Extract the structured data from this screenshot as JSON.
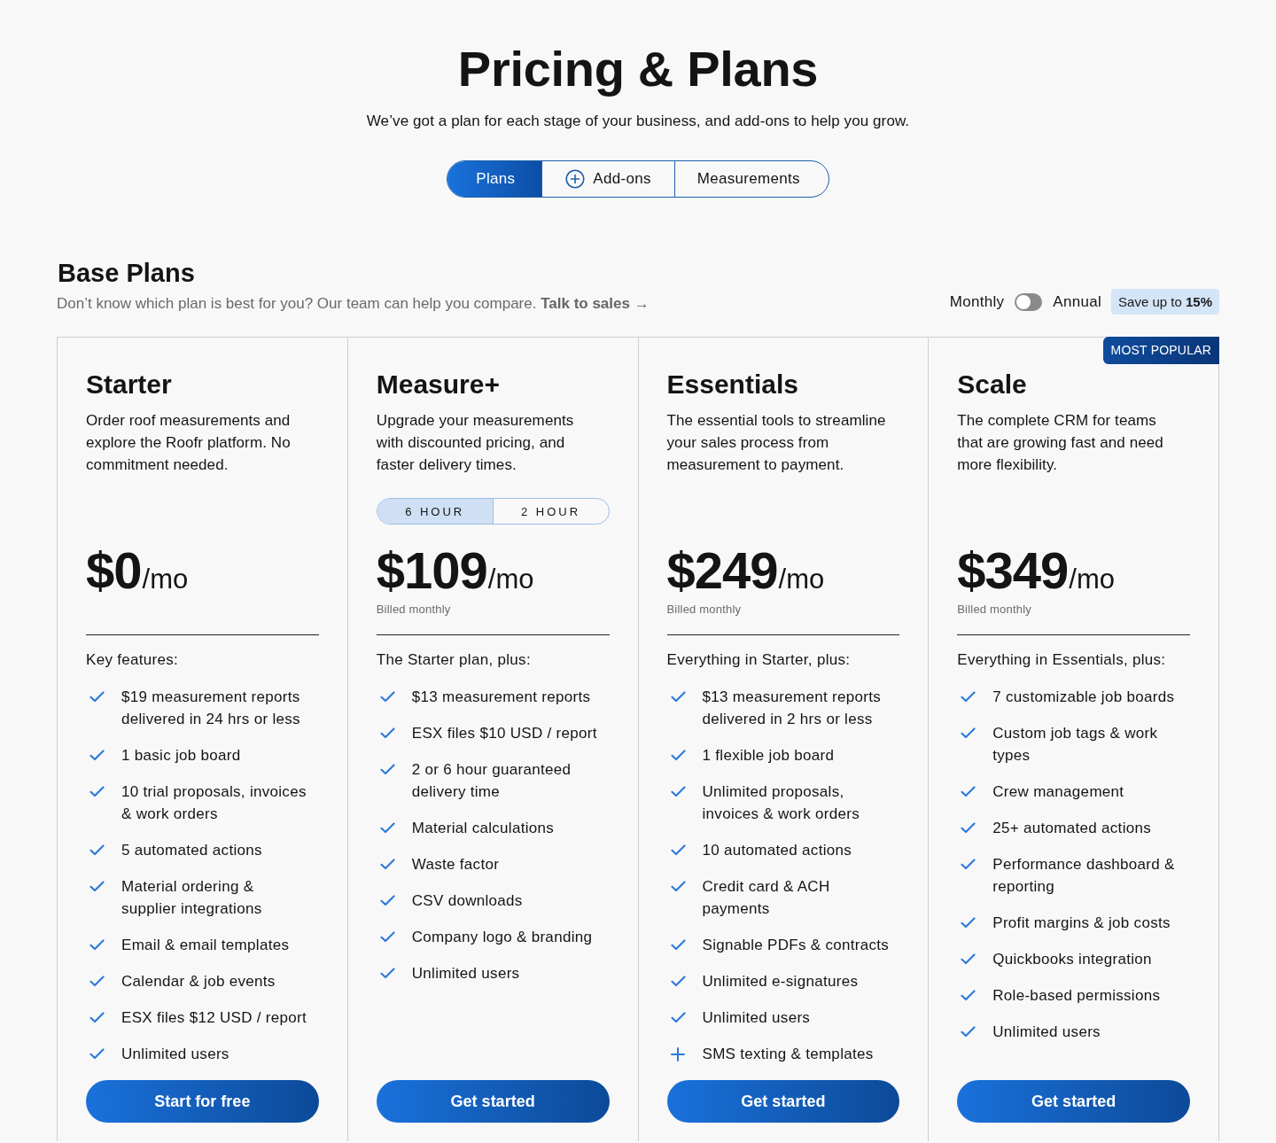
{
  "header": {
    "title": "Pricing & Plans",
    "subtitle": "We’ve got a plan for each stage of your business, and add-ons to help you grow."
  },
  "tabs": [
    {
      "label": "Plans",
      "selected": true,
      "icon": false
    },
    {
      "label": "Add-ons",
      "selected": false,
      "icon": true
    },
    {
      "label": "Measurements",
      "selected": false,
      "icon": false
    }
  ],
  "base_plans": {
    "title": "Base Plans",
    "subtitle": "Don’t know which plan is best for you? Our team can help you compare.",
    "link": "Talk to sales →",
    "billing": {
      "monthly_label": "Monthly",
      "toggle": {
        "on": false
      },
      "annual_label": "Annual",
      "savings": "Save up to **15%**"
    }
  },
  "plans": [
    {
      "name": "Starter",
      "description": "Order roof measurements and explore the Roofr platform. No commitment needed.",
      "price": "$0",
      "period": "/mo",
      "features_heading": "Key features:",
      "features": [
        {
          "kind": "check",
          "text": "$19 measurement reports delivered in 24 hrs or less"
        },
        {
          "kind": "check",
          "text": "1 basic job board"
        },
        {
          "kind": "check",
          "text": "10 trial proposals, invoices & work orders"
        },
        {
          "kind": "check",
          "text": "5 automated actions"
        },
        {
          "kind": "check",
          "text": "Material ordering & supplier integrations"
        },
        {
          "kind": "check",
          "text": "Email & email templates"
        },
        {
          "kind": "check",
          "text": "Calendar & job events"
        },
        {
          "kind": "check",
          "text": "ESX files $12 USD / report"
        },
        {
          "kind": "check",
          "text": "Unlimited users"
        }
      ],
      "button": "Start for free"
    },
    {
      "name": "Measure+",
      "description": "Upgrade your measurements with discounted pricing, and faster delivery times.",
      "delivery_options": [
        {
          "label": "6 HOUR",
          "selected": true
        },
        {
          "label": "2 HOUR",
          "selected": false
        }
      ],
      "price": "$109",
      "period": "/mo",
      "billed": "Billed monthly",
      "features_heading": "The Starter plan, plus:",
      "features": [
        {
          "kind": "check",
          "text": "$13 measurement reports"
        },
        {
          "kind": "check",
          "text": "ESX files $10 USD / report"
        },
        {
          "kind": "check",
          "text": "2 or 6 hour guaranteed delivery time"
        },
        {
          "kind": "check",
          "text": "Material calculations"
        },
        {
          "kind": "check",
          "text": "Waste factor"
        },
        {
          "kind": "check",
          "text": "CSV downloads"
        },
        {
          "kind": "check",
          "text": "Company logo & branding"
        },
        {
          "kind": "check",
          "text": "Unlimited users"
        }
      ],
      "button": "Get started"
    },
    {
      "name": "Essentials",
      "description": "The essential tools to streamline your sales process from measurement to payment.",
      "price": "$249",
      "period": "/mo",
      "billed": "Billed monthly",
      "features_heading": "Everything in Starter, plus:",
      "features": [
        {
          "kind": "check",
          "text": "$13 measurement reports delivered in 2 hrs or less"
        },
        {
          "kind": "check",
          "text": "1 flexible job board"
        },
        {
          "kind": "check",
          "text": "Unlimited proposals, invoices & work orders"
        },
        {
          "kind": "check",
          "text": "10 automated actions"
        },
        {
          "kind": "check",
          "text": "Credit card & ACH payments"
        },
        {
          "kind": "check",
          "text": "Signable PDFs & contracts"
        },
        {
          "kind": "check",
          "text": "Unlimited e-signatures"
        },
        {
          "kind": "check",
          "text": "Unlimited users"
        },
        {
          "kind": "plus",
          "text": "SMS texting & templates"
        }
      ],
      "button": "Get started"
    },
    {
      "name": "Scale",
      "badge": "MOST POPULAR",
      "description": "The complete CRM for teams that are growing fast and need more flexibility.",
      "price": "$349",
      "period": "/mo",
      "billed": "Billed monthly",
      "features_heading": "Everything in Essentials, plus:",
      "features": [
        {
          "kind": "check",
          "text": "7 customizable job boards"
        },
        {
          "kind": "check",
          "text": "Custom job tags & work types"
        },
        {
          "kind": "check",
          "text": "Crew management"
        },
        {
          "kind": "check",
          "text": "25+ automated actions"
        },
        {
          "kind": "check",
          "text": "Performance dashboard & reporting"
        },
        {
          "kind": "check",
          "text": "Profit margins & job costs"
        },
        {
          "kind": "check",
          "text": "Quickbooks integration"
        },
        {
          "kind": "check",
          "text": "Role-based permissions"
        },
        {
          "kind": "check",
          "text": "Unlimited users"
        }
      ],
      "button": "Get started"
    }
  ]
}
